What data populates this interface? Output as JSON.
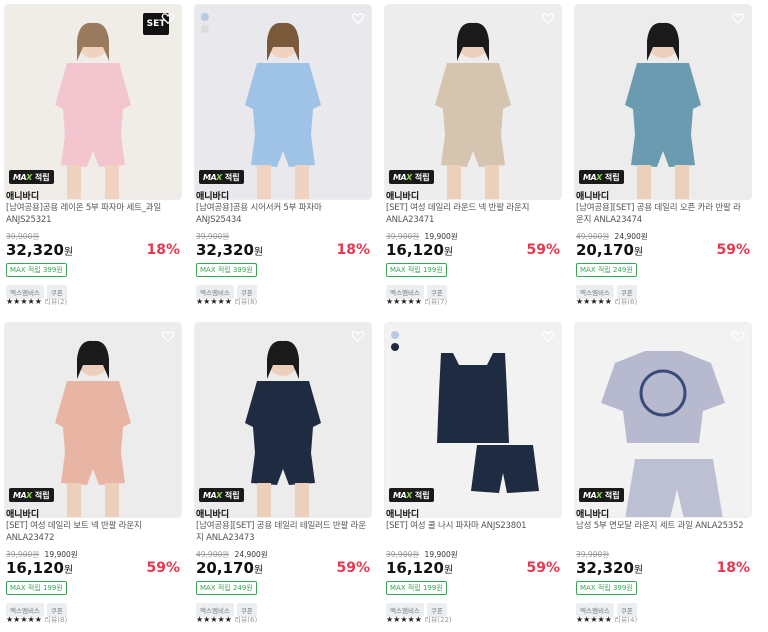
{
  "accent": "#e8384f",
  "max_accent": "#3aa655",
  "products": [
    {
      "brand": "애니바디",
      "title": "[남여공용]공용 레이온 5부 파자마 세트_과일 ANJS25321",
      "original_price": "39,900원",
      "mid_price": "",
      "price": "32,320",
      "won": "원",
      "discount": "18%",
      "max_point": "MAX 적립 399원",
      "chips": [
        "엑스엠비스",
        "쿠폰"
      ],
      "stars": "★★★★★",
      "reviews": "리뷰(2)",
      "badge": "SET",
      "swatches": [],
      "max_tag": "적립",
      "bg": "#f0ece8",
      "main": "#f3c6cf",
      "hair": "#9a7a5c",
      "skin": "#f0d2c0"
    },
    {
      "brand": "애니바디",
      "title": "[남여공용]공용 시어서커 5부 파자마 ANJS25434",
      "original_price": "39,900원",
      "mid_price": "",
      "price": "32,320",
      "won": "원",
      "discount": "18%",
      "max_point": "MAX 적립 399원",
      "chips": [
        "엑스엠비스",
        "쿠폰"
      ],
      "stars": "★★★★★",
      "reviews": "리뷰(8)",
      "badge": "",
      "swatches": [
        "#b8c8e6",
        "#dcdcdc"
      ],
      "max_tag": "적립",
      "bg": "#e9e9ed",
      "main": "#9fc3e6",
      "hair": "#7a5a3a",
      "skin": "#f0d2c0"
    },
    {
      "brand": "애니바디",
      "title": "[SET] 여성 데일리 라운드 넥 반팔 라운지 ANLA23471",
      "original_price": "39,900원",
      "mid_price": "19,900원",
      "price": "16,120",
      "won": "원",
      "discount": "59%",
      "max_point": "MAX 적립 199원",
      "chips": [
        "엑스엠비스",
        "쿠폰"
      ],
      "stars": "★★★★★",
      "reviews": "리뷰(7)",
      "badge": "",
      "swatches": [],
      "max_tag": "적립",
      "bg": "#ededed",
      "main": "#d4c4b0",
      "hair": "#1a1a1a",
      "skin": "#ecd0bc"
    },
    {
      "brand": "애니바디",
      "title": "[남여공용][SET] 공용 데일리 오픈 카라 반팔 라운지 ANLA23474",
      "original_price": "49,900원",
      "mid_price": "24,900원",
      "price": "20,170",
      "won": "원",
      "discount": "59%",
      "max_point": "MAX 적립 249원",
      "chips": [
        "엑스엠비스",
        "쿠폰"
      ],
      "stars": "★★★★★",
      "reviews": "리뷰(6)",
      "badge": "",
      "swatches": [],
      "max_tag": "적립",
      "bg": "#ececec",
      "main": "#6b9bb0",
      "hair": "#1a1a1a",
      "skin": "#ecd0bc"
    },
    {
      "brand": "애니바디",
      "title": "[SET] 여성 데일리 보트 넥 반팔 라운지 ANLA23472",
      "original_price": "39,900원",
      "mid_price": "19,900원",
      "price": "16,120",
      "won": "원",
      "discount": "59%",
      "max_point": "MAX 적립 199원",
      "chips": [
        "엑스엠비스",
        "쿠폰"
      ],
      "stars": "★★★★★",
      "reviews": "리뷰(8)",
      "badge": "",
      "swatches": [],
      "max_tag": "적립",
      "bg": "#ececec",
      "main": "#e8b4a4",
      "hair": "#1a1a1a",
      "skin": "#ecd0bc"
    },
    {
      "brand": "애니바디",
      "title": "[남여공용][SET] 공용 데일리 테일러드 반팔 라운지 ANLA23473",
      "original_price": "49,900원",
      "mid_price": "24,900원",
      "price": "20,170",
      "won": "원",
      "discount": "59%",
      "max_point": "MAX 적립 249원",
      "chips": [
        "엑스엠비스",
        "쿠폰"
      ],
      "stars": "★★★★★",
      "reviews": "리뷰(6)",
      "badge": "",
      "swatches": [],
      "max_tag": "적립",
      "bg": "#ececec",
      "main": "#1f2b40",
      "hair": "#1a1a1a",
      "skin": "#ecd0bc"
    },
    {
      "brand": "애니바디",
      "title": "[SET] 여성 쿨 나시 파자마 ANJS23801",
      "original_price": "39,900원",
      "mid_price": "19,900원",
      "price": "16,120",
      "won": "원",
      "discount": "59%",
      "max_point": "MAX 적립 199원",
      "chips": [
        "엑스엠비스",
        "쿠폰"
      ],
      "stars": "★★★★★",
      "reviews": "리뷰(22)",
      "badge": "",
      "swatches": [
        "#b8c8e6",
        "#1f2b40"
      ],
      "max_tag": "적립",
      "bg": "#f2f2f2",
      "main": "#1f2b40",
      "hair": "",
      "skin": ""
    },
    {
      "brand": "애니바디",
      "title": "남성 5부 면모달 라운지 세트 과일 ANLA25352",
      "original_price": "39,900원",
      "mid_price": "",
      "price": "32,320",
      "won": "원",
      "discount": "18%",
      "max_point": "MAX 적립 399원",
      "chips": [
        "엑스엠비스",
        "쿠폰"
      ],
      "stars": "★★★★★",
      "reviews": "리뷰(4)",
      "badge": "",
      "swatches": [],
      "max_tag": "적립",
      "bg": "#f2f2f2",
      "main": "#b7b9cf",
      "hair": "",
      "skin": ""
    }
  ]
}
